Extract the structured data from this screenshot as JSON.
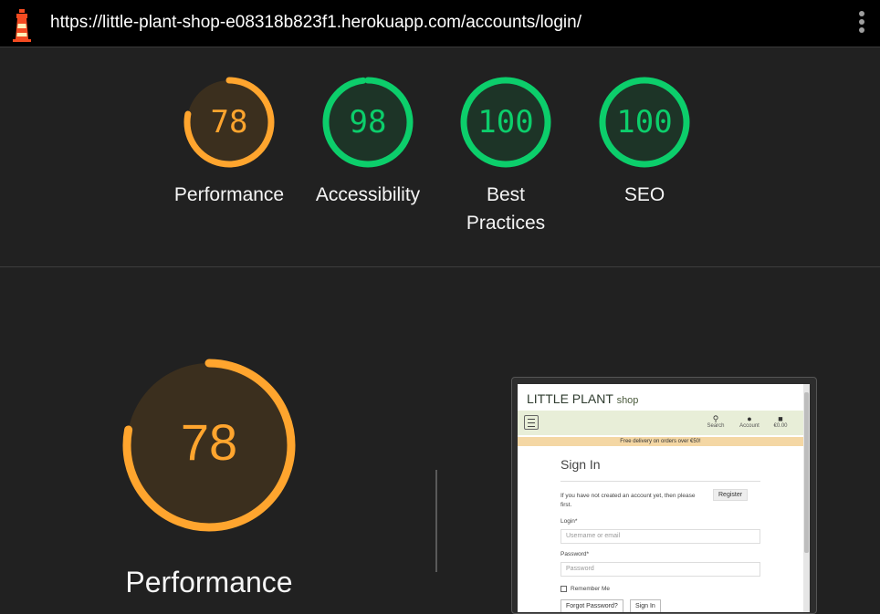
{
  "topbar": {
    "url": "https://little-plant-shop-e08318b823f1.herokuapp.com/accounts/login/",
    "logo_icon": "lighthouse-icon",
    "menu_icon": "kebab-menu-icon"
  },
  "gauges": [
    {
      "score": "78",
      "label": "Performance",
      "value": 0.78,
      "color": "#ffa52e",
      "bg": "#3b2f1e"
    },
    {
      "score": "98",
      "label": "Accessibility",
      "value": 0.98,
      "color": "#0cce6b",
      "bg": "#1d3427"
    },
    {
      "score": "100",
      "label": "Best Practices",
      "value": 1.0,
      "color": "#0cce6b",
      "bg": "#1d3427"
    },
    {
      "score": "100",
      "label": "SEO",
      "value": 1.0,
      "color": "#0cce6b",
      "bg": "#1d3427"
    }
  ],
  "main": {
    "score": "78",
    "value": 0.78,
    "label": "Performance",
    "color": "#ffa52e"
  },
  "screenshot": {
    "brand": "LITTLE PLANT",
    "brand_suffix": "shop",
    "nav": [
      {
        "icon": "search-icon",
        "label": "Search"
      },
      {
        "icon": "user-icon",
        "label": "Account"
      },
      {
        "icon": "bag-icon",
        "label": "€0.00"
      }
    ],
    "banner": "Free delivery on orders over €50!",
    "title": "Sign In",
    "intro": "If you have not created an account yet, then please",
    "intro_end": "first.",
    "register": "Register",
    "login_label": "Login*",
    "login_placeholder": "Username or email",
    "password_label": "Password*",
    "password_placeholder": "Password",
    "remember": "Remember Me",
    "forgot": "Forgot Password?",
    "signin": "Sign In"
  }
}
